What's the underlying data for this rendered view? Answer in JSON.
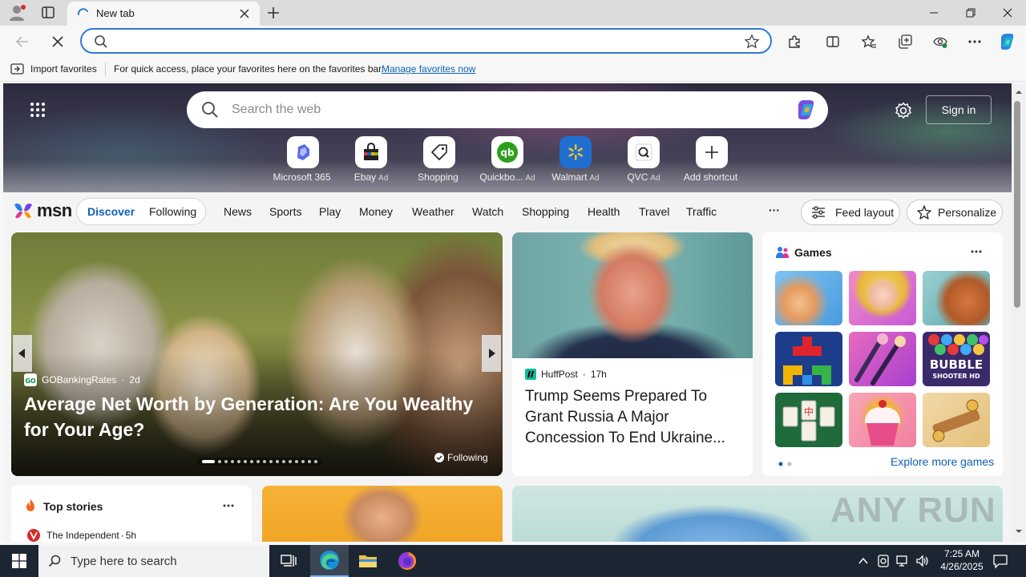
{
  "browser": {
    "tab_title": "New tab",
    "favorites_bar": {
      "import_label": "Import favorites",
      "message": "For quick access, place your favorites here on the favorites bar.",
      "manage_link": "Manage favorites now"
    }
  },
  "hero": {
    "search_placeholder": "Search the web",
    "sign_in": "Sign in",
    "shortcuts": [
      {
        "label": "Microsoft 365",
        "ad": ""
      },
      {
        "label": "Ebay",
        "ad": "Ad"
      },
      {
        "label": "Shopping",
        "ad": ""
      },
      {
        "label": "Quickbo...",
        "ad": "Ad"
      },
      {
        "label": "Walmart",
        "ad": "Ad"
      },
      {
        "label": "QVC",
        "ad": "Ad"
      },
      {
        "label": "Add shortcut",
        "ad": ""
      }
    ]
  },
  "msn": {
    "logo": "msn",
    "pill": {
      "discover": "Discover",
      "following": "Following"
    },
    "nav": [
      "News",
      "Sports",
      "Play",
      "Money",
      "Weather",
      "Watch",
      "Shopping",
      "Health",
      "Travel",
      "Traffic"
    ],
    "more": "···",
    "feed_layout": "Feed layout",
    "personalize": "Personalize"
  },
  "feed": {
    "big_card": {
      "source": "GOBankingRates",
      "age": "2d",
      "headline": "Average Net Worth by Generation: Are You Wealthy for Your Age?",
      "following": "Following"
    },
    "news_card": {
      "source": "HuffPost",
      "age": "17h",
      "headline": "Trump Seems Prepared To Grant Russia A Major Concession To End Ukraine..."
    },
    "games": {
      "title": "Games",
      "explore": "Explore more games",
      "tiles": [
        "puzzle-kitchen",
        "fashion-doll",
        "home-makeover",
        "block-puzzle",
        "makeup-brushes",
        "bubble-shooter",
        "mahjong",
        "cupcake",
        "wood-nuts"
      ],
      "bubble_text": "BUBBLE",
      "bubble_sub": "SHOOTER HD"
    },
    "top_stories": {
      "title": "Top stories",
      "source": "The Independent",
      "age": "5h"
    },
    "watermark": "ANY RUN"
  },
  "taskbar": {
    "search_placeholder": "Type here to search",
    "time": "7:25 AM",
    "date": "4/26/2025"
  },
  "colors": {
    "accent": "#0f60b6",
    "taskbar": "#1c2633",
    "omnibox_border": "#2f7bd8"
  }
}
